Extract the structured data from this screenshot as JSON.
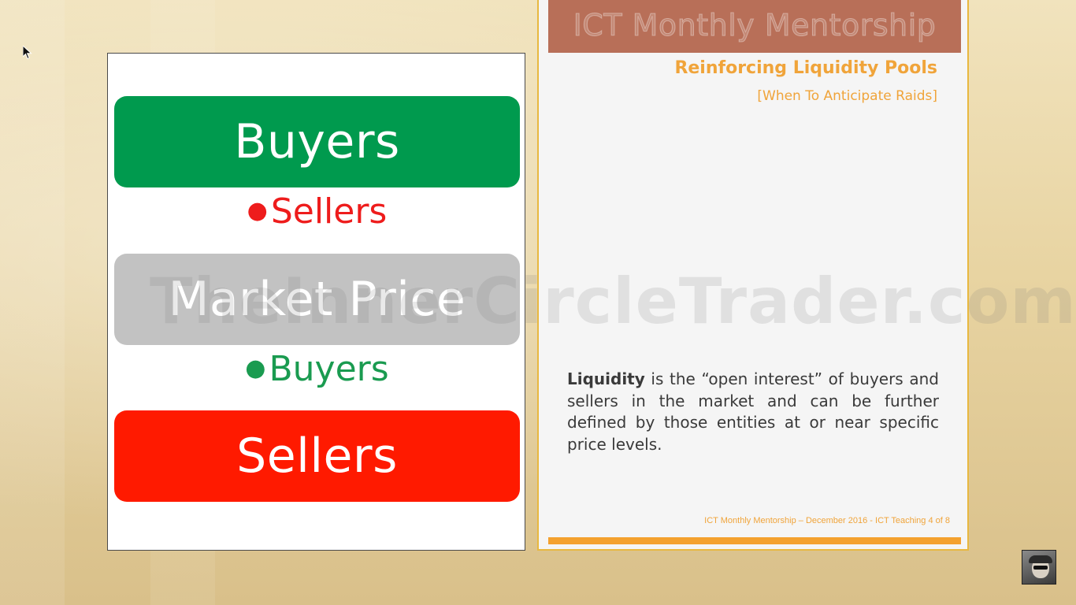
{
  "left_slide": {
    "box_top": "Buyers",
    "bullet_top": "Sellers",
    "box_middle": "Market Price",
    "bullet_bottom": "Buyers",
    "box_bottom": "Sellers",
    "colors": {
      "buyers": "#009a4e",
      "market": "#c2c2c2",
      "sellers": "#ff1a00"
    }
  },
  "right_slide": {
    "header": "ICT Monthly Mentorship",
    "subtitle": "Reinforcing Liquidity Pools",
    "subtitle2": "[When To Anticipate Raids]",
    "para_bold": "Liquidity",
    "para_rest": " is the “open interest” of buyers and sellers in the market and can be further defined by those entities at or near specific price levels.",
    "footer": "ICT Monthly Mentorship – December 2016 - ICT Teaching 4 of 8",
    "colors": {
      "header_band": "#b86f58",
      "accent": "#f0a43a",
      "footer_bar": "#f4a12e"
    }
  },
  "watermark": "TheInnerCircleTrader.com",
  "icons": {
    "cursor": "mouse-pointer-icon",
    "avatar": "presenter-avatar"
  }
}
